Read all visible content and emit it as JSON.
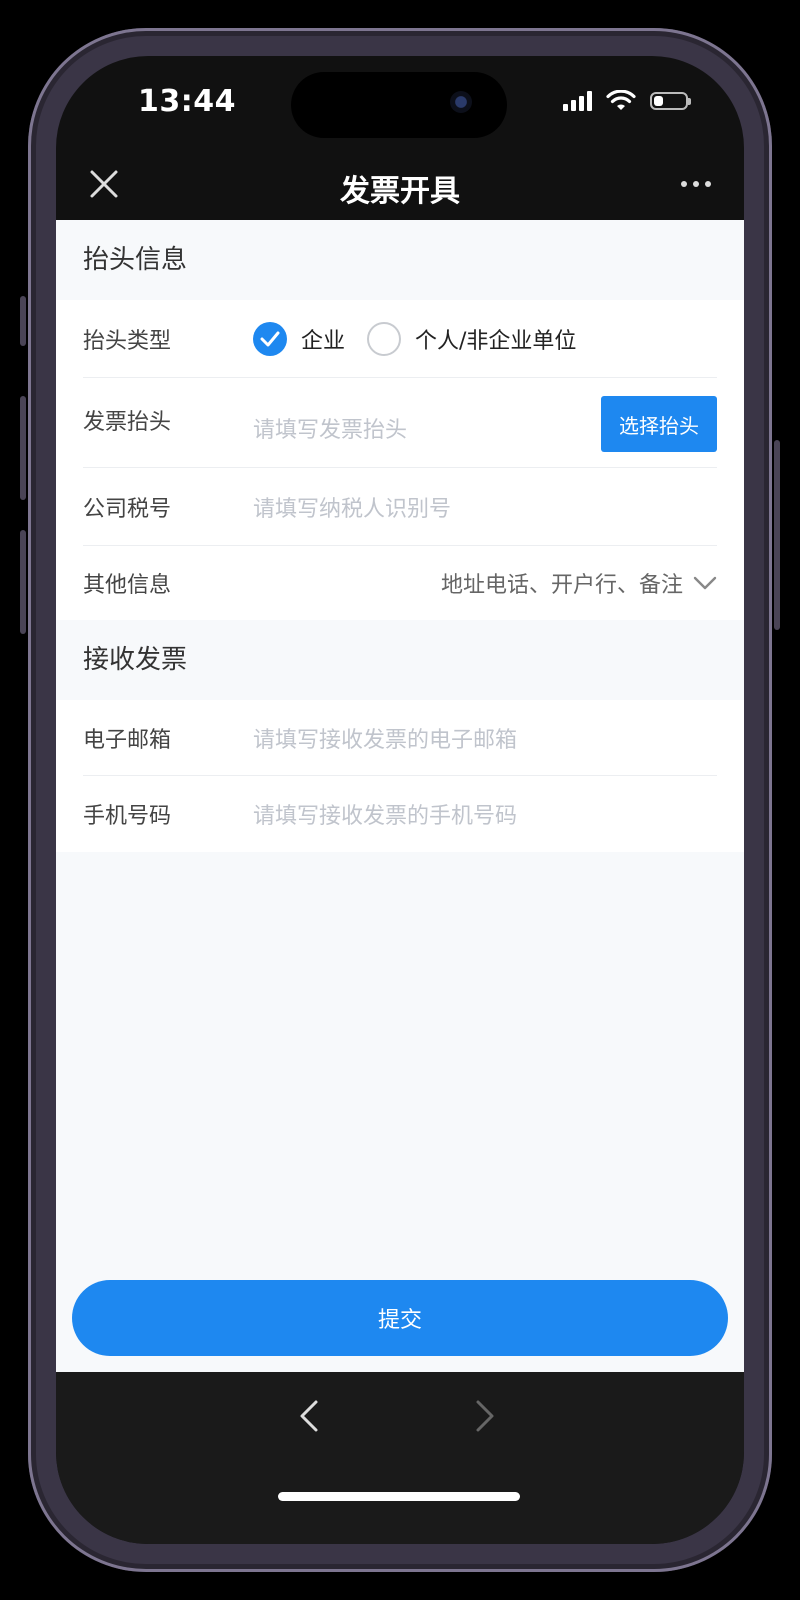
{
  "status_bar": {
    "time": "13:44",
    "icons": [
      "signal-icon",
      "wifi-icon",
      "battery-icon"
    ],
    "battery_level": 0.25
  },
  "navbar": {
    "title": "发票开具",
    "close_icon": "close-icon",
    "more_icon": "more-icon"
  },
  "header_section": {
    "title": "抬头信息",
    "type_row": {
      "label": "抬头类型",
      "options": [
        {
          "label": "企业",
          "checked": true
        },
        {
          "label": "个人/非企业单位",
          "checked": false
        }
      ]
    },
    "title_row": {
      "label": "发票抬头",
      "placeholder": "请填写发票抬头",
      "button_label": "选择抬头"
    },
    "tax_row": {
      "label": "公司税号",
      "placeholder": "请填写纳税人识别号"
    },
    "other_row": {
      "label": "其他信息",
      "value": "地址电话、开户行、备注",
      "icon": "chevron-down-icon"
    }
  },
  "receive_section": {
    "title": "接收发票",
    "email_row": {
      "label": "电子邮箱",
      "placeholder": "请填写接收发票的电子邮箱"
    },
    "phone_row": {
      "label": "手机号码",
      "placeholder": "请填写接收发票的手机号码"
    }
  },
  "submit": {
    "label": "提交"
  },
  "colors": {
    "accent": "#1e88f0",
    "page_background": "#f7f9fb",
    "navbar_background": "#111111"
  }
}
